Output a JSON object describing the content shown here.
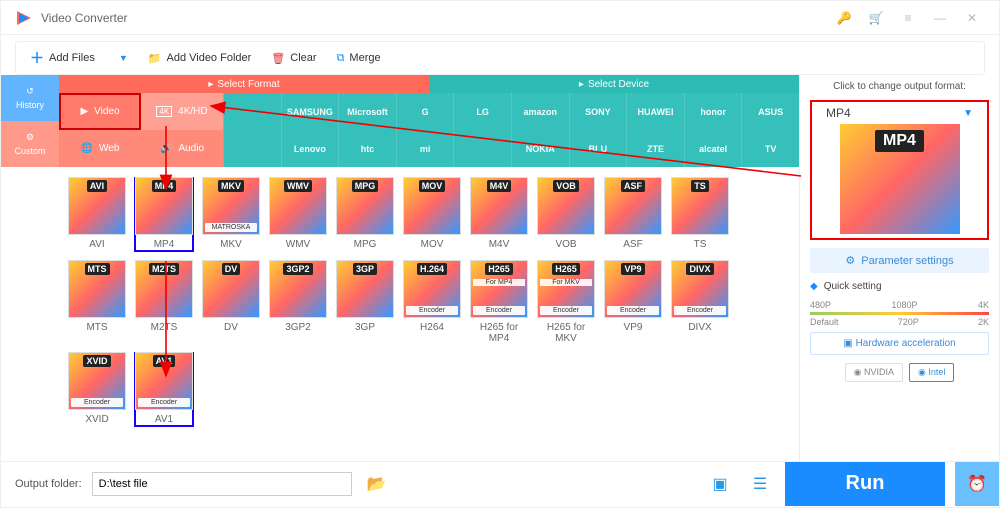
{
  "window": {
    "title": "Video Converter"
  },
  "toolbar": {
    "add_files": "Add Files",
    "add_folder": "Add Video Folder",
    "clear": "Clear",
    "merge": "Merge"
  },
  "leftnav": {
    "history": "History",
    "custom": "Custom"
  },
  "tabs": {
    "select_format": "Select Format",
    "select_device": "Select Device"
  },
  "categories": {
    "video": "Video",
    "hd": "4K/HD",
    "web": "Web",
    "audio": "Audio"
  },
  "devices": {
    "row1": [
      "",
      "SAMSUNG",
      "Microsoft",
      "G",
      "LG",
      "amazon",
      "SONY",
      "HUAWEI",
      "honor",
      "ASUS"
    ],
    "row2": [
      "",
      "Lenovo",
      "htc",
      "mi",
      "",
      "NOKIA",
      "BLU",
      "ZTE",
      "alcatel",
      "TV"
    ]
  },
  "formats": [
    [
      {
        "tag": "AVI",
        "label": "AVI"
      },
      {
        "tag": "MP4",
        "label": "MP4",
        "sel": true
      },
      {
        "tag": "MKV",
        "label": "MKV",
        "sub": "MATROSKA"
      },
      {
        "tag": "WMV",
        "label": "WMV"
      },
      {
        "tag": "MPG",
        "label": "MPG"
      },
      {
        "tag": "MOV",
        "label": "MOV"
      },
      {
        "tag": "M4V",
        "label": "M4V"
      },
      {
        "tag": "VOB",
        "label": "VOB"
      },
      {
        "tag": "ASF",
        "label": "ASF"
      },
      {
        "tag": "TS",
        "label": "TS"
      }
    ],
    [
      {
        "tag": "MTS",
        "label": "MTS"
      },
      {
        "tag": "M2TS",
        "label": "M2TS"
      },
      {
        "tag": "DV",
        "label": "DV"
      },
      {
        "tag": "3GP2",
        "label": "3GP2"
      },
      {
        "tag": "3GP",
        "label": "3GP"
      },
      {
        "tag": "H.264",
        "label": "H264",
        "sub": "Encoder"
      },
      {
        "tag": "H265",
        "label": "H265 for MP4",
        "sub": "Encoder",
        "mid": "For MP4"
      },
      {
        "tag": "H265",
        "label": "H265 for MKV",
        "sub": "Encoder",
        "mid": "For MKV"
      },
      {
        "tag": "VP9",
        "label": "VP9",
        "sub": "Encoder"
      },
      {
        "tag": "DIVX",
        "label": "DIVX",
        "sub": "Encoder"
      }
    ],
    [
      {
        "tag": "XVID",
        "label": "XVID",
        "sub": "Encoder"
      },
      {
        "tag": "AV1",
        "label": "AV1",
        "sub": "Encoder",
        "sel": true
      }
    ]
  ],
  "preview": {
    "hint": "Click to change output format:",
    "format": "MP4"
  },
  "right": {
    "param": "Parameter settings",
    "quick": "Quick setting",
    "ticks_top": [
      "480P",
      "1080P",
      "4K"
    ],
    "ticks_bot": [
      "Default",
      "720P",
      "2K"
    ],
    "hwacc": "Hardware acceleration",
    "gpu": [
      "NVIDIA",
      "Intel"
    ]
  },
  "bottom": {
    "label": "Output folder:",
    "value": "D:\\test file",
    "run": "Run"
  }
}
